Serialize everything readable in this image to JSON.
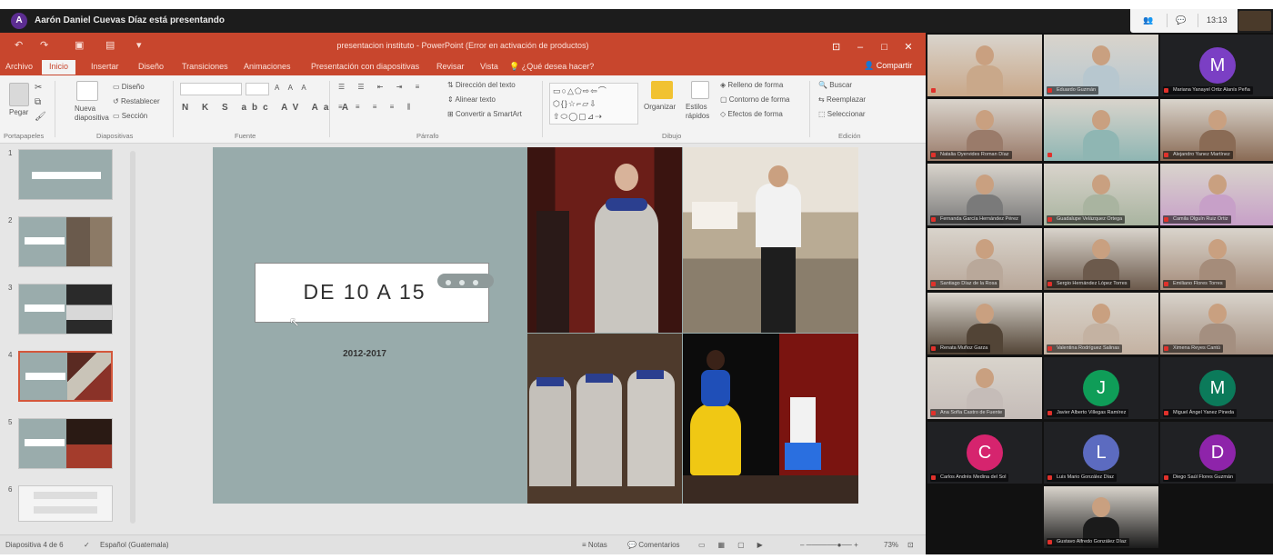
{
  "meeting": {
    "presenter_avatar": "A",
    "presenter_text": "Aarón Daniel Cuevas Díaz está presentando",
    "time": "13:13"
  },
  "ppt": {
    "title": "presentacion instituto - PowerPoint (Error en activación de productos)",
    "tabs": [
      "Archivo",
      "Inicio",
      "Insertar",
      "Diseño",
      "Transiciones",
      "Animaciones",
      "Presentación con diapositivas",
      "Revisar",
      "Vista"
    ],
    "active_tab": "Inicio",
    "tell_me": "¿Qué desea hacer?",
    "share": "Compartir",
    "ribbon": {
      "paste": "Pegar",
      "new_slide": "Nueva diapositiva",
      "diseno": "Diseño",
      "restablecer": "Restablecer",
      "seccion": "Sección",
      "groups": [
        "Portapapeles",
        "Diapositivas",
        "Fuente",
        "Párrafo",
        "Dibujo",
        "Edición"
      ],
      "text_direction": "Dirección del texto",
      "align_text": "Alinear texto",
      "smartart": "Convertir a SmartArt",
      "organizar": "Organizar",
      "estilos": "Estilos rápidos",
      "relleno": "Relleno de forma",
      "contorno": "Contorno de forma",
      "efectos": "Efectos de forma",
      "buscar": "Buscar",
      "reemplazar": "Reemplazar",
      "seleccionar": "Seleccionar"
    },
    "slide_numbers": [
      "1",
      "2",
      "3",
      "4",
      "5",
      "6"
    ],
    "slide": {
      "title": "DE 10 A 15",
      "years": "2012-2017"
    },
    "status": {
      "slide_count": "Diapositiva 4 de 6",
      "language": "Español (Guatemala)",
      "notes": "Notas",
      "comments": "Comentarios",
      "zoom": "73%"
    }
  },
  "participants": [
    {
      "name": "",
      "initial": "",
      "color": "#c9a88a"
    },
    {
      "name": "Eduardo Guzmán",
      "initial": "",
      "color": "#b7c7cf"
    },
    {
      "name": "Mariana Yanayel Ortiz Alanís Peña",
      "initial": "M",
      "color": "#7b3fc4"
    },
    {
      "name": "Natalia Oyervides Roman Díaz",
      "initial": "",
      "color": "#9a7b6a"
    },
    {
      "name": "",
      "initial": "",
      "color": "#8fb6b3"
    },
    {
      "name": "Alejandro Yanez Martínez",
      "initial": "",
      "color": "#8a6b55"
    },
    {
      "name": "Fernanda García Hernández Pérez",
      "initial": "",
      "color": "#7a7a7a"
    },
    {
      "name": "Guadalupe Velázquez Ortega",
      "initial": "",
      "color": "#a9b4a0"
    },
    {
      "name": "Camila Olguín Ruiz Ortiz",
      "initial": "",
      "color": "#c7a0c8"
    },
    {
      "name": "Santiago Díaz de la Rosa",
      "initial": "",
      "color": "#b9a89a"
    },
    {
      "name": "Sergio Hernández López Torres",
      "initial": "",
      "color": "#6c5a4c"
    },
    {
      "name": "Emiliano Flores Torres",
      "initial": "",
      "color": "#a58c7a"
    },
    {
      "name": "Renata Muñoz Garza",
      "initial": "",
      "color": "#524436"
    },
    {
      "name": "Valentina Rodríguez Salinas",
      "initial": "",
      "color": "#c4b2a2"
    },
    {
      "name": "Ximena Reyes Cantú",
      "initial": "",
      "color": "#a48f80"
    },
    {
      "name": "Ana Sofía Castro de Fuente",
      "initial": "",
      "color": "#c5bcb8"
    },
    {
      "name": "Javier Alberto Villegas Ramírez",
      "initial": "J",
      "color": "#0f9d58"
    },
    {
      "name": "Miguel Ángel Yanez Pineda",
      "initial": "M",
      "color": "#0b7a5a"
    },
    {
      "name": "Carlos Andrés Medina del Sol",
      "initial": "C",
      "color": "#d6246e"
    },
    {
      "name": "Luis Mario González Díaz",
      "initial": "L",
      "color": "#5c6bc0"
    },
    {
      "name": "Diego Saúl Flores Guzmán",
      "initial": "D",
      "color": "#8e24aa"
    },
    {
      "name": "Gustavo Alfredo González Díaz",
      "initial": "",
      "color": "#1b1b1b"
    }
  ]
}
